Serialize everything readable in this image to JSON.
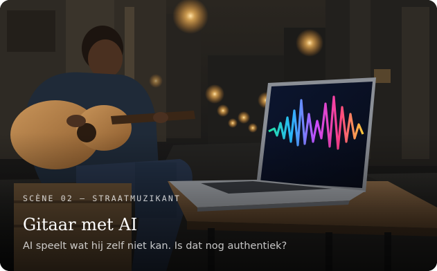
{
  "card": {
    "eyebrow": "SCÈNE 02 — STRAATMUZIKANT",
    "title": "Gitaar met AI",
    "subtitle": "AI speelt wat hij zelf niet kan. Is dat nog authentiek?"
  },
  "colors": {
    "street_lamp": "#ffcf7a",
    "night_sky": "#1d1f24",
    "waveform_low": "#2ad1ff",
    "waveform_mid": "#ff3fb0",
    "waveform_high": "#ffc83a"
  }
}
